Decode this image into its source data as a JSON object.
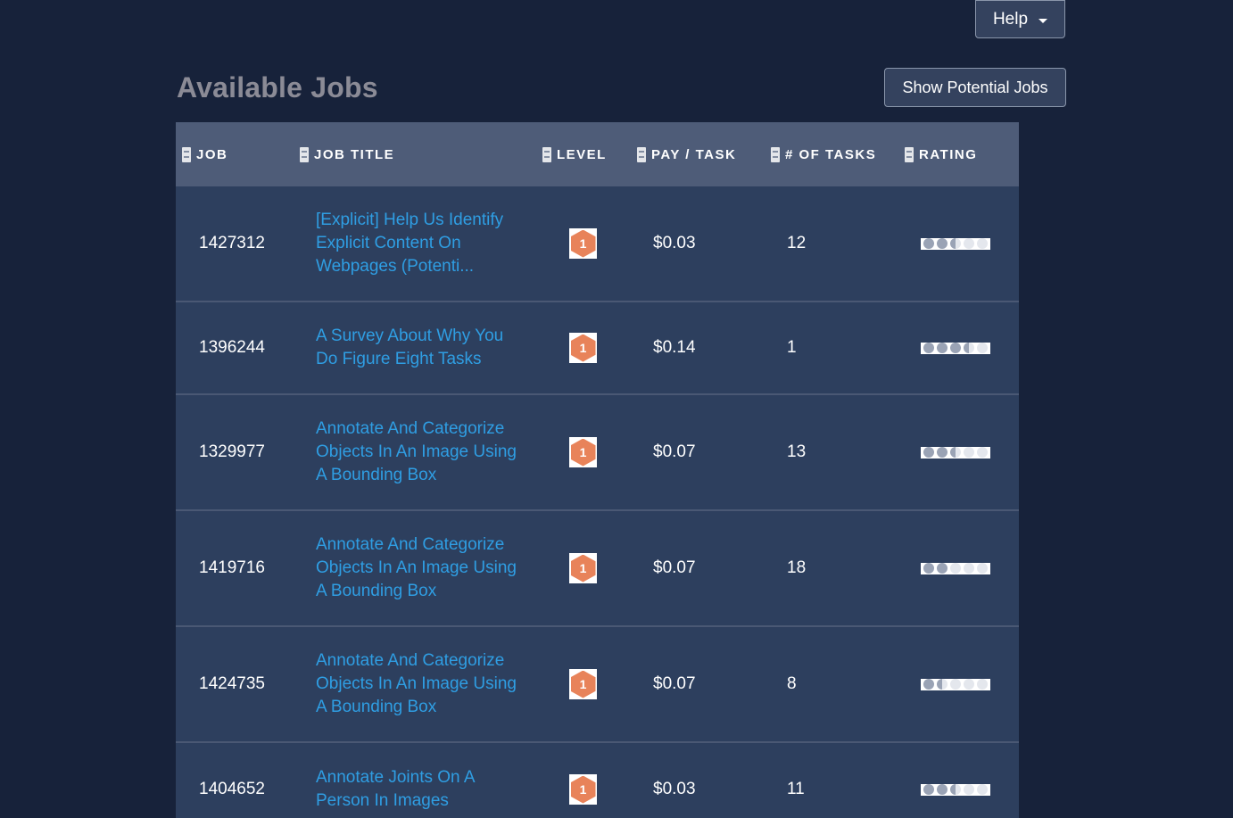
{
  "header": {
    "help_label": "Help",
    "potential_jobs_label": "Show Potential Jobs"
  },
  "page_title": "Available Jobs",
  "table": {
    "columns": [
      "JOB",
      "JOB TITLE",
      "LEVEL",
      "PAY / TASK",
      "# OF TASKS",
      "RATING"
    ],
    "rows": [
      {
        "job": "1427312",
        "title": "[Explicit] Help Us Identify Explicit Content On Webpages (Potenti...",
        "level": "1",
        "pay": "$0.03",
        "tasks": "12",
        "rating": 2.5
      },
      {
        "job": "1396244",
        "title": "A Survey About Why You Do Figure Eight Tasks",
        "level": "1",
        "pay": "$0.14",
        "tasks": "1",
        "rating": 3.5
      },
      {
        "job": "1329977",
        "title": "Annotate And Categorize Objects In An Image Using A Bounding Box",
        "level": "1",
        "pay": "$0.07",
        "tasks": "13",
        "rating": 2.5
      },
      {
        "job": "1419716",
        "title": "Annotate And Categorize Objects In An Image Using A Bounding Box",
        "level": "1",
        "pay": "$0.07",
        "tasks": "18",
        "rating": 2
      },
      {
        "job": "1424735",
        "title": "Annotate And Categorize Objects In An Image Using A Bounding Box",
        "level": "1",
        "pay": "$0.07",
        "tasks": "8",
        "rating": 1.5
      },
      {
        "job": "1404652",
        "title": "Annotate Joints On A Person In Images",
        "level": "1",
        "pay": "$0.03",
        "tasks": "11",
        "rating": 2.5
      }
    ]
  },
  "colors": {
    "background": "#17223a",
    "link": "#2f9ee3",
    "level_badge": "#e8835a"
  }
}
